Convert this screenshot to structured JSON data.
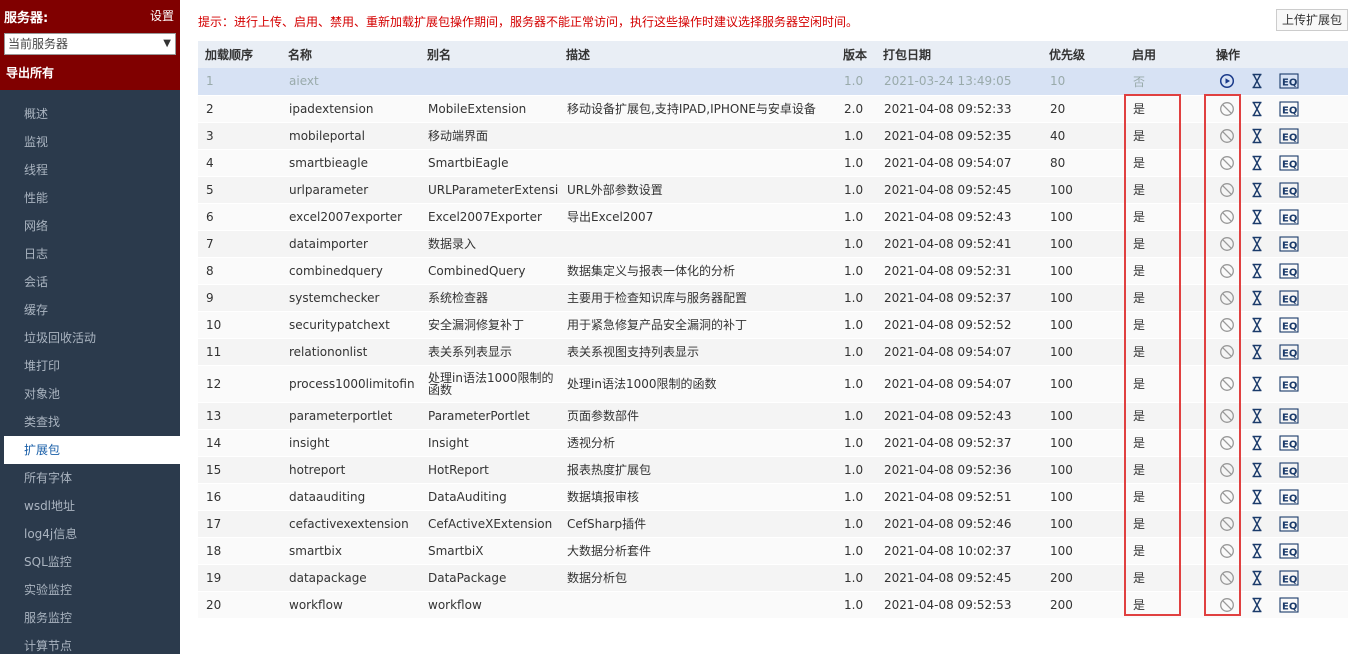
{
  "sidebar": {
    "title": "服务器:",
    "settings_label": "设置",
    "server_select": "当前服务器",
    "export_all": "导出所有",
    "menu": [
      "概述",
      "监视",
      "线程",
      "性能",
      "网络",
      "日志",
      "会话",
      "缓存",
      "垃圾回收活动",
      "堆打印",
      "对象池",
      "类查找",
      "扩展包",
      "所有字体",
      "wsdl地址",
      "log4j信息",
      "SQL监控",
      "实验监控",
      "服务监控",
      "计算节点"
    ],
    "active_index": 12
  },
  "main": {
    "notice": "提示：进行上传、启用、禁用、重新加载扩展包操作期间，服务器不能正常访问，执行这些操作时建议选择服务器空闲时间。",
    "upload_button": "上传扩展包",
    "columns": [
      "加载顺序",
      "名称",
      "别名",
      "描述",
      "版本",
      "打包日期",
      "优先级",
      "启用",
      "操作"
    ],
    "rows": [
      {
        "order": "1",
        "name": "aiext",
        "alias": "",
        "desc": "",
        "version": "1.0",
        "date": "2021-03-24 13:49:05",
        "priority": "10",
        "enabled": "否"
      },
      {
        "order": "2",
        "name": "ipadextension",
        "alias": "MobileExtension",
        "desc": "移动设备扩展包,支持IPAD,IPHONE与安卓设备",
        "version": "2.0",
        "date": "2021-04-08 09:52:33",
        "priority": "20",
        "enabled": "是"
      },
      {
        "order": "3",
        "name": "mobileportal",
        "alias": "移动端界面",
        "desc": "",
        "version": "1.0",
        "date": "2021-04-08 09:52:35",
        "priority": "40",
        "enabled": "是"
      },
      {
        "order": "4",
        "name": "smartbieagle",
        "alias": "SmartbiEagle",
        "desc": "",
        "version": "1.0",
        "date": "2021-04-08 09:54:07",
        "priority": "80",
        "enabled": "是"
      },
      {
        "order": "5",
        "name": "urlparameter",
        "alias": "URLParameterExtension",
        "desc": "URL外部参数设置",
        "version": "1.0",
        "date": "2021-04-08 09:52:45",
        "priority": "100",
        "enabled": "是"
      },
      {
        "order": "6",
        "name": "excel2007exporter",
        "alias": "Excel2007Exporter",
        "desc": "导出Excel2007",
        "version": "1.0",
        "date": "2021-04-08 09:52:43",
        "priority": "100",
        "enabled": "是"
      },
      {
        "order": "7",
        "name": "dataimporter",
        "alias": "数据录入",
        "desc": "",
        "version": "1.0",
        "date": "2021-04-08 09:52:41",
        "priority": "100",
        "enabled": "是"
      },
      {
        "order": "8",
        "name": "combinedquery",
        "alias": "CombinedQuery",
        "desc": "数据集定义与报表一体化的分析",
        "version": "1.0",
        "date": "2021-04-08 09:52:31",
        "priority": "100",
        "enabled": "是"
      },
      {
        "order": "9",
        "name": "systemchecker",
        "alias": "系统检查器",
        "desc": "主要用于检查知识库与服务器配置",
        "version": "1.0",
        "date": "2021-04-08 09:52:37",
        "priority": "100",
        "enabled": "是"
      },
      {
        "order": "10",
        "name": "securitypatchext",
        "alias": "安全漏洞修复补丁",
        "desc": "用于紧急修复产品安全漏洞的补丁",
        "version": "1.0",
        "date": "2021-04-08 09:52:52",
        "priority": "100",
        "enabled": "是"
      },
      {
        "order": "11",
        "name": "relationonlist",
        "alias": "表关系列表显示",
        "desc": "表关系视图支持列表显示",
        "version": "1.0",
        "date": "2021-04-08 09:54:07",
        "priority": "100",
        "enabled": "是"
      },
      {
        "order": "12",
        "name": "process1000limitofin",
        "alias": "处理in语法1000限制的函数",
        "desc": "处理in语法1000限制的函数",
        "version": "1.0",
        "date": "2021-04-08 09:54:07",
        "priority": "100",
        "enabled": "是"
      },
      {
        "order": "13",
        "name": "parameterportlet",
        "alias": "ParameterPortlet",
        "desc": "页面参数部件",
        "version": "1.0",
        "date": "2021-04-08 09:52:43",
        "priority": "100",
        "enabled": "是"
      },
      {
        "order": "14",
        "name": "insight",
        "alias": "Insight",
        "desc": "透视分析",
        "version": "1.0",
        "date": "2021-04-08 09:52:37",
        "priority": "100",
        "enabled": "是"
      },
      {
        "order": "15",
        "name": "hotreport",
        "alias": "HotReport",
        "desc": "报表热度扩展包",
        "version": "1.0",
        "date": "2021-04-08 09:52:36",
        "priority": "100",
        "enabled": "是"
      },
      {
        "order": "16",
        "name": "dataauditing",
        "alias": "DataAuditing",
        "desc": "数据填报审核",
        "version": "1.0",
        "date": "2021-04-08 09:52:51",
        "priority": "100",
        "enabled": "是"
      },
      {
        "order": "17",
        "name": "cefactivexextension",
        "alias": "CefActiveXExtension",
        "desc": "CefSharp插件",
        "version": "1.0",
        "date": "2021-04-08 09:52:46",
        "priority": "100",
        "enabled": "是"
      },
      {
        "order": "18",
        "name": "smartbix",
        "alias": "SmartbiX",
        "desc": "大数据分析套件",
        "version": "1.0",
        "date": "2021-04-08 10:02:37",
        "priority": "100",
        "enabled": "是"
      },
      {
        "order": "19",
        "name": "datapackage",
        "alias": "DataPackage",
        "desc": "数据分析包",
        "version": "1.0",
        "date": "2021-04-08 09:52:45",
        "priority": "200",
        "enabled": "是"
      },
      {
        "order": "20",
        "name": "workflow",
        "alias": "workflow",
        "desc": "",
        "version": "1.0",
        "date": "2021-04-08 09:52:53",
        "priority": "200",
        "enabled": "是"
      }
    ]
  },
  "colors": {
    "header_bg": "#800000",
    "sidebar_bg": "#2b3a4c",
    "notice": "#d40000",
    "highlight": "#e04040",
    "selected_row": "#d7e2f4"
  },
  "icons": {
    "enable": "play-circle-icon",
    "disable": "ban-icon",
    "reload": "hourglass-icon",
    "detail": "eq-icon"
  }
}
